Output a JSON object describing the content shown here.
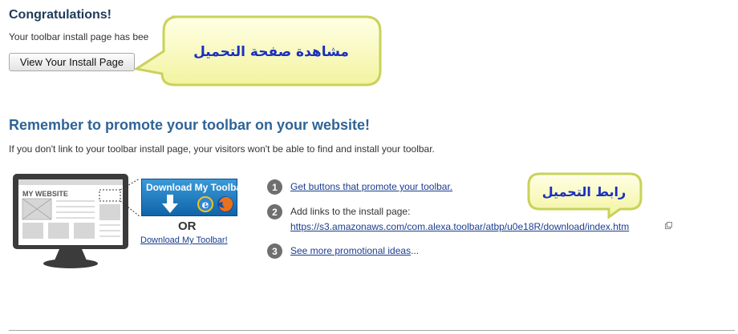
{
  "congrats": {
    "title": "Congratulations!",
    "message": "Your toolbar install page has bee",
    "button_label": "View Your Install Page"
  },
  "callouts": {
    "install_page": "مشاهدة صفحة التحميل",
    "install_link": "رابط التحميل"
  },
  "promote": {
    "heading": "Remember to promote your toolbar on your website!",
    "description": "If you don't link to your toolbar install page, your visitors won't be able to find and install your toolbar."
  },
  "illustration": {
    "monitor_label": "MY WEBSITE",
    "download_button_label": "Download My Toolbar!",
    "or_label": "OR",
    "download_text_link": "Download My Toolbar!"
  },
  "steps": [
    {
      "number": "1",
      "text": "Get buttons that promote your toolbar."
    },
    {
      "number": "2",
      "text": "Add links to the install page:",
      "url": "https://s3.amazonaws.com/com.alexa.toolbar/atbp/u0e18R/download/index.htm"
    },
    {
      "number": "3",
      "text": "See more promotional ideas",
      "suffix": "..."
    }
  ],
  "colors": {
    "heading": "#2f6496",
    "link": "#1a3d8f",
    "callout_fill": "#fdfdc4",
    "callout_border": "#c9d25a",
    "callout_text": "#1a2fbf"
  }
}
